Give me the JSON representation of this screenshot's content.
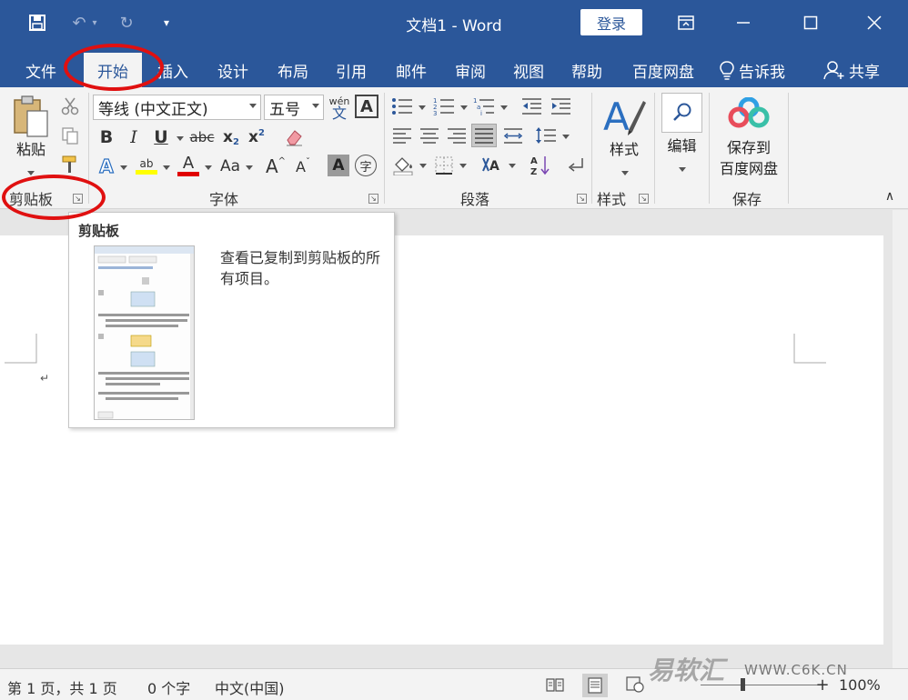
{
  "window": {
    "title": "文档1  -  Word",
    "login_label": "登录"
  },
  "tabs": [
    {
      "label": "文件"
    },
    {
      "label": "开始"
    },
    {
      "label": "插入"
    },
    {
      "label": "设计"
    },
    {
      "label": "布局"
    },
    {
      "label": "引用"
    },
    {
      "label": "邮件"
    },
    {
      "label": "审阅"
    },
    {
      "label": "视图"
    },
    {
      "label": "帮助"
    },
    {
      "label": "百度网盘"
    }
  ],
  "tell_me": "告诉我",
  "share": "共享",
  "ribbon": {
    "clipboard": {
      "label": "剪贴板",
      "paste": "粘贴"
    },
    "font": {
      "label": "字体",
      "font_name": "等线 (中文正文)",
      "font_size": "五号",
      "phonetic_top": "wén",
      "phonetic_bottom": "文",
      "bold": "B",
      "italic": "I",
      "underline": "U",
      "strike": "abc",
      "sub": "x",
      "sup": "x",
      "change_case": "Aa",
      "grow": "A",
      "shrink": "A",
      "char_shading": "A",
      "enclose": "字",
      "highlight_text": "ab",
      "color_text": "A",
      "effects_text": "A"
    },
    "paragraph": {
      "label": "段落"
    },
    "styles": {
      "label": "样式",
      "button": "样式"
    },
    "editing": {
      "button": "编辑"
    },
    "save": {
      "label": "保存",
      "button_line1": "保存到",
      "button_line2": "百度网盘"
    }
  },
  "tooltip": {
    "title": "剪贴板",
    "description": "查看已复制到剪贴板的所有项目。"
  },
  "document": {
    "paragraph_mark": "↵"
  },
  "status": {
    "page": "第 1 页，共 1 页",
    "words": "0 个字",
    "language": "中文(中国)",
    "zoom": "100%"
  },
  "watermark": {
    "brand": "易软汇",
    "url": "WWW.C6K.CN"
  },
  "colors": {
    "accent": "#2b579a",
    "annotation": "#e01010"
  }
}
